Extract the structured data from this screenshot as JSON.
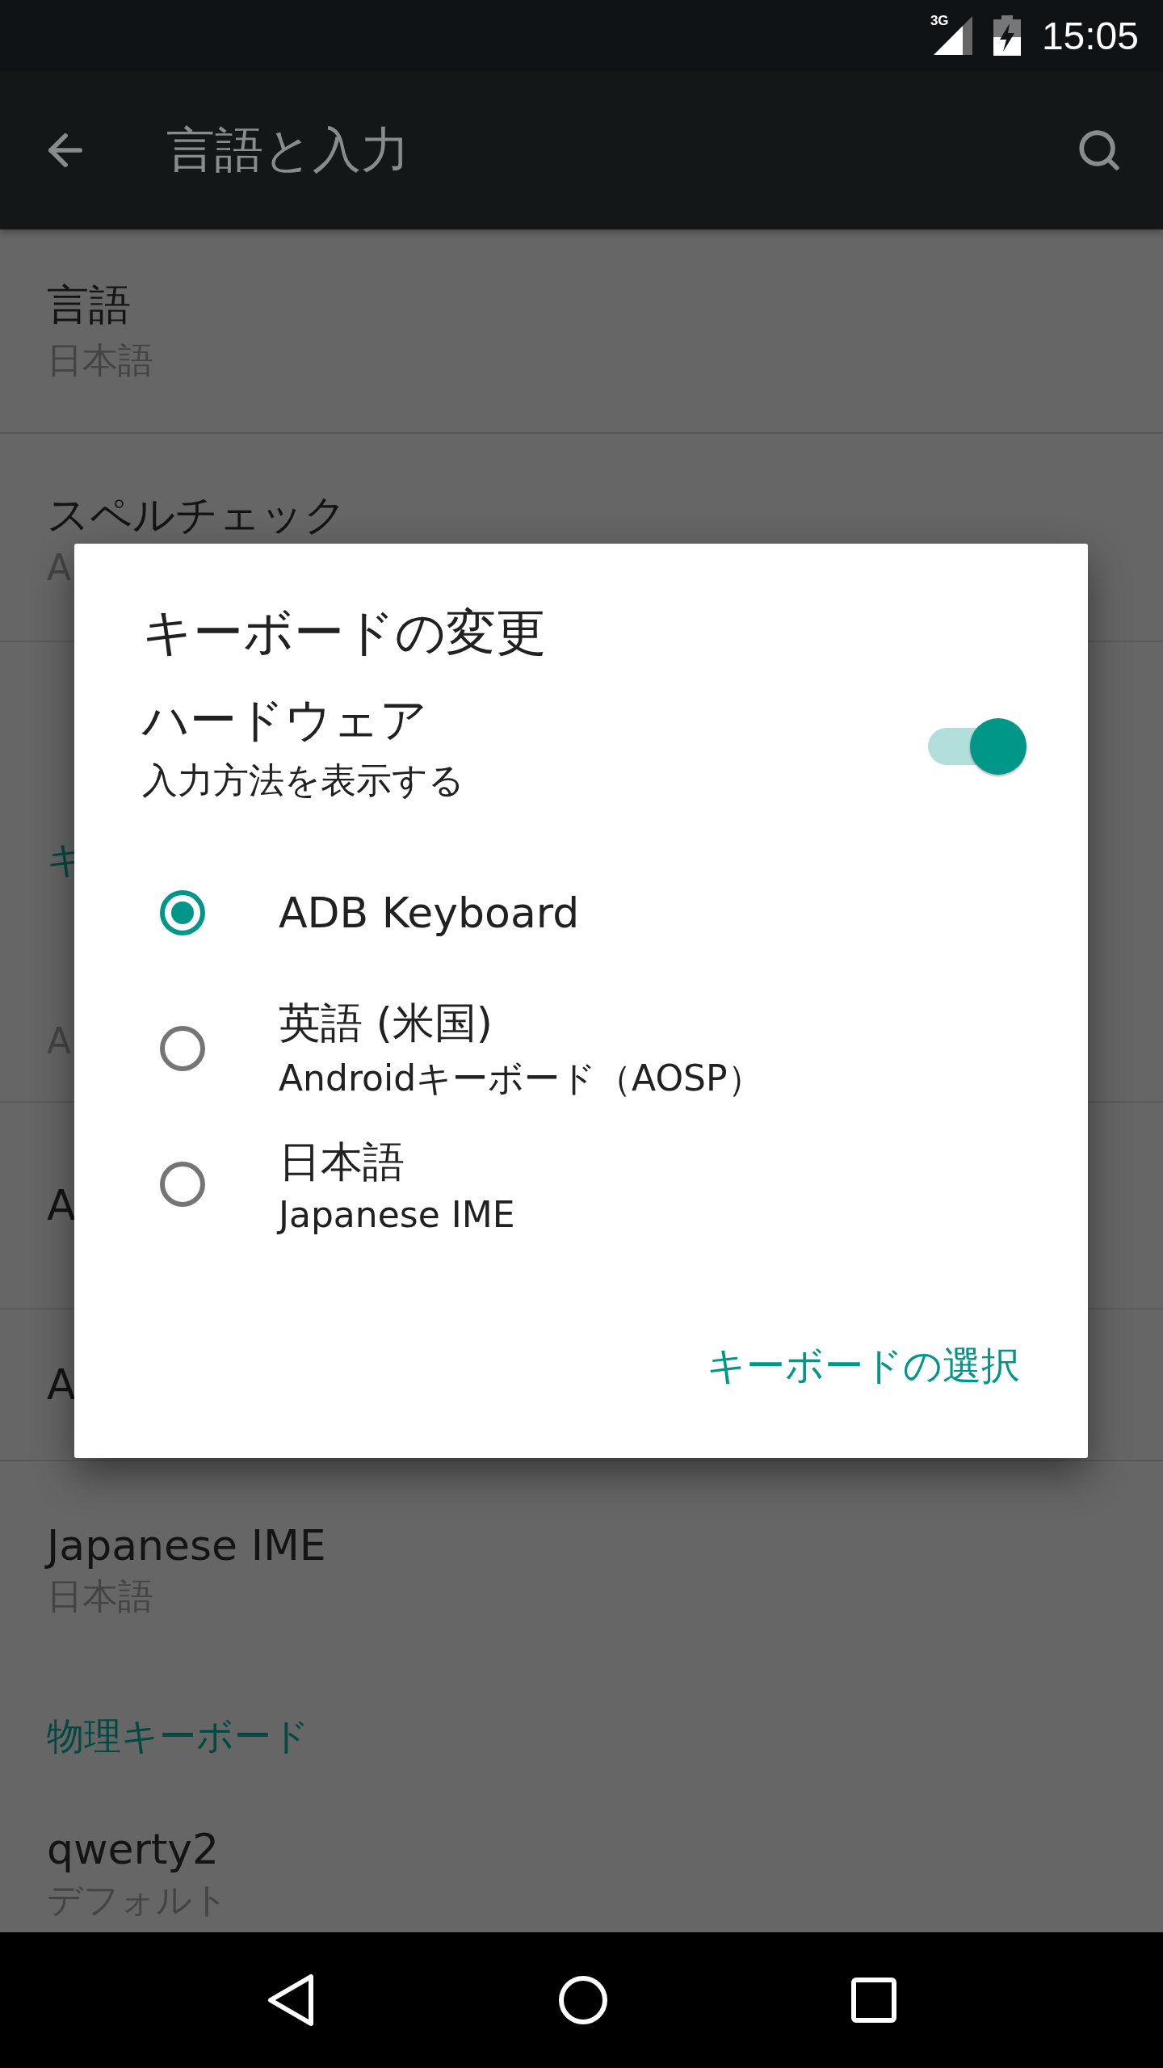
{
  "status_bar": {
    "network": "3G",
    "time": "15:05"
  },
  "app_bar": {
    "title": "言語と入力"
  },
  "settings": [
    {
      "kind": "item",
      "title": "言語",
      "subtitle": "日本語"
    },
    {
      "kind": "item",
      "title": "スペルチェック",
      "subtitle": "A"
    },
    {
      "kind": "item"
    },
    {
      "kind": "header",
      "title": "キ"
    },
    {
      "kind": "item",
      "subtitle": "A"
    },
    {
      "kind": "item",
      "title": "A"
    },
    {
      "kind": "item",
      "title": "A"
    },
    {
      "kind": "item",
      "title": "Japanese IME",
      "subtitle": "日本語"
    },
    {
      "kind": "header",
      "title": "物理キーボード"
    },
    {
      "kind": "item",
      "title": "qwerty2",
      "subtitle": "デフォルト"
    }
  ],
  "dialog": {
    "title": "キーボードの変更",
    "hardware": {
      "title": "ハードウェア",
      "subtitle": "入力方法を表示する",
      "on": true
    },
    "options": [
      {
        "title": "ADB Keyboard",
        "selected": true
      },
      {
        "title": "英語 (米国)",
        "subtitle": "Androidキーボード（AOSP）",
        "selected": false
      },
      {
        "title": "日本語",
        "subtitle": "Japanese IME",
        "selected": false
      }
    ],
    "button": "キーボードの選択"
  }
}
